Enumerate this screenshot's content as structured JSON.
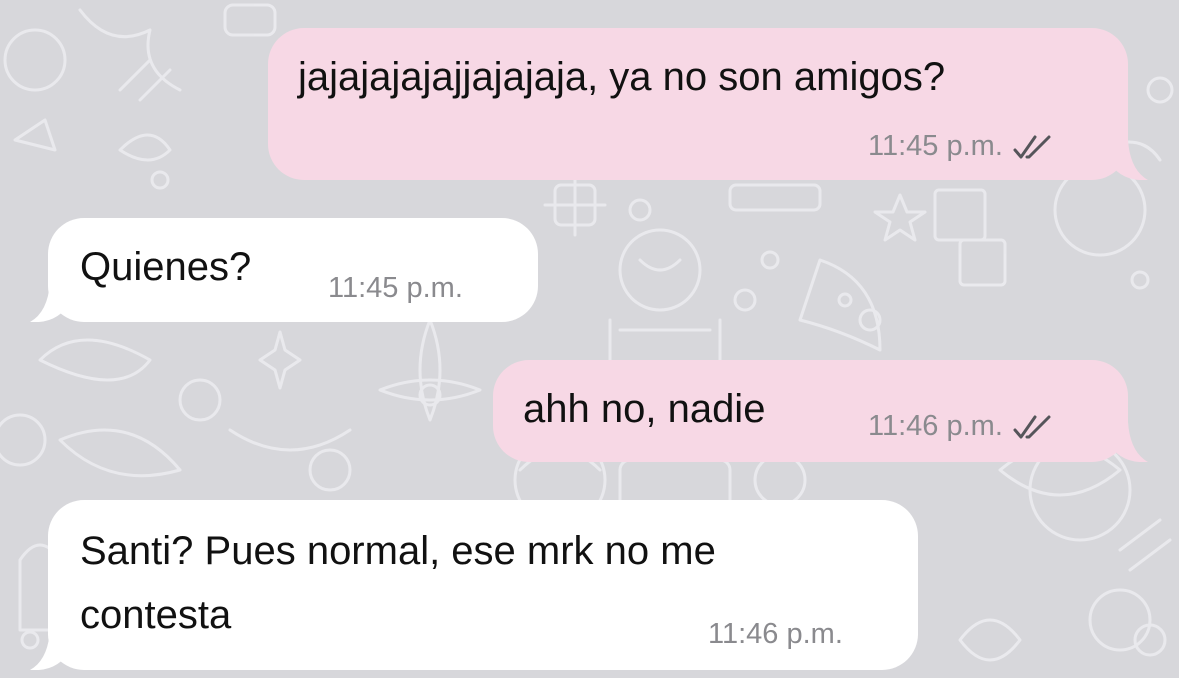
{
  "chat": {
    "messages": [
      {
        "direction": "out",
        "text": "jajajajajajjajajaja, ya no son amigos?",
        "time": "11:45 p.m.",
        "status_icon": "double-check-read-icon"
      },
      {
        "direction": "in",
        "text": "Quienes?",
        "time": "11:45 p.m."
      },
      {
        "direction": "out",
        "text": "ahh no, nadie",
        "time": "11:46 p.m.",
        "status_icon": "double-check-read-icon"
      },
      {
        "direction": "in",
        "text_lines": [
          "Santi? Pues normal, ese mrk no me",
          "contesta"
        ],
        "time": "11:46 p.m."
      }
    ]
  },
  "colors": {
    "background": "#d7d7db",
    "outgoing_bubble": "#f7d8e5",
    "incoming_bubble": "#ffffff",
    "text": "#111111",
    "meta_text": "#8a8a8e"
  }
}
